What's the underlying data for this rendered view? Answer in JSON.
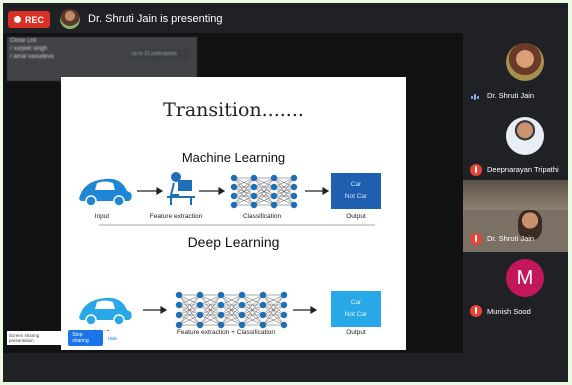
{
  "top_bar": {
    "rec_label": "REC",
    "presenter_text": "Dr. Shruti Jain is presenting"
  },
  "chat_overlay": {
    "lines": [
      "Close List",
      "/ surjeet singh",
      "/ amal vasudeva"
    ],
    "tag": "Up to 21 participants"
  },
  "slide": {
    "title": "Transition.......",
    "ml_title": "Machine Learning",
    "dl_title": "Deep Learning",
    "labels": {
      "input": "Input",
      "feature_extraction": "Feature extraction",
      "classification": "Classification",
      "output": "Output",
      "fe_classification": "Feature extraction + Classification"
    },
    "output_box": {
      "car": "Car",
      "not_car": "Not Car"
    }
  },
  "toast": {
    "text": "Screen sharing presentation",
    "stop_label": "Stop sharing",
    "hide_label": "Hide"
  },
  "participants": [
    {
      "name": "Dr. Shruti Jain",
      "muted": false
    },
    {
      "name": "Deepnarayan Tripathi",
      "muted": true
    },
    {
      "name": "Dr. Shruti Jain",
      "muted": true
    },
    {
      "name": "Munish Sood",
      "initial": "M",
      "muted": true,
      "avatar_color": "#c2185b"
    }
  ],
  "colors": {
    "rec": "#d93025",
    "output_box_ml": "#1f5fb0",
    "output_box_dl": "#29a8e8",
    "car": "#1f86d6",
    "mute": "#ea4335"
  }
}
